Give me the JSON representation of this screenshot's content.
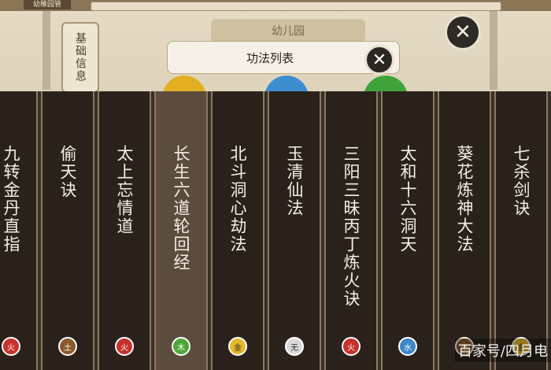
{
  "topbar": {
    "tab_label": "幼稚园管"
  },
  "side_tab": {
    "label": "基础信息"
  },
  "background": {
    "kindergarten_label": "幼儿园"
  },
  "panel": {
    "title": "功法列表"
  },
  "techniques": [
    {
      "name": "九转金丹直指",
      "element": "火",
      "color": "#c6312c",
      "selected": false
    },
    {
      "name": "偷天诀",
      "element": "土",
      "color": "#8b5a2b",
      "selected": false
    },
    {
      "name": "太上忘情道",
      "element": "火",
      "color": "#c6312c",
      "selected": false
    },
    {
      "name": "长生六道轮回经",
      "element": "木",
      "color": "#4fa73a",
      "selected": true
    },
    {
      "name": "北斗洞心劫法",
      "element": "金",
      "color": "#e7b82a",
      "selected": false
    },
    {
      "name": "玉清仙法",
      "element": "无",
      "color": "#d8d8d8",
      "selected": false
    },
    {
      "name": "三阳三昧丙丁炼火诀",
      "element": "火",
      "color": "#c6312c",
      "selected": false
    },
    {
      "name": "太和十六洞天",
      "element": "水",
      "color": "#3d86c9",
      "selected": false
    },
    {
      "name": "葵花炼神大法",
      "element": "土",
      "color": "#8b5a2b",
      "selected": false
    },
    {
      "name": "七杀剑诀",
      "element": "金",
      "color": "#e7b82a",
      "selected": false
    }
  ],
  "watermark": {
    "text": "百家号/四月电"
  }
}
